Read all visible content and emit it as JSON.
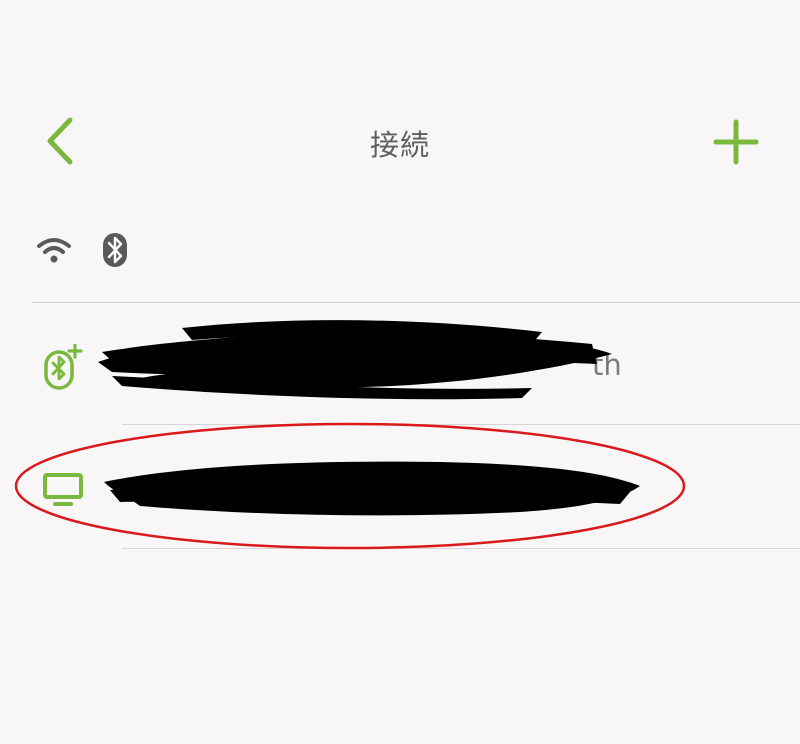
{
  "header": {
    "title": "接続",
    "back_icon": "chevron-left-icon",
    "add_icon": "plus-icon"
  },
  "status": {
    "wifi_icon": "wifi-icon",
    "bluetooth_icon": "bluetooth-icon"
  },
  "connections": [
    {
      "icon": "bluetooth-device-add-icon",
      "label_visible": "th"
    },
    {
      "icon": "monitor-icon",
      "label_visible": ""
    }
  ],
  "colors": {
    "accent": "#7ab93d",
    "background": "#f8f6f7",
    "divider": "#d7d5d6",
    "text": "#5e5e5e",
    "annotation": "#d9191c",
    "redaction": "#000000"
  }
}
